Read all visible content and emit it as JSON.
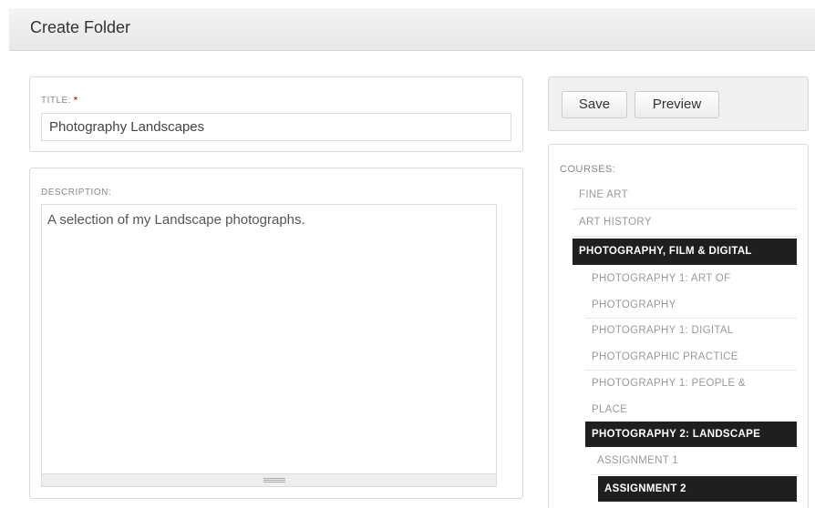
{
  "header": {
    "title": "Create Folder"
  },
  "form": {
    "title_label": "TITLE:",
    "required_marker": "*",
    "title_value": "Photography Landscapes",
    "description_label": "DESCRIPTION:",
    "description_value": "A selection of my Landscape photographs."
  },
  "actions": {
    "save_label": "Save",
    "preview_label": "Preview"
  },
  "courses": {
    "label": "COURSES:",
    "fine_art": "FINE ART",
    "art_history": "ART HISTORY",
    "photo_film_digital": "PHOTOGRAPHY, FILM & DIGITAL",
    "photo1_art_line1": "PHOTOGRAPHY 1: ART OF",
    "photo1_art_line2": "PHOTOGRAPHY",
    "photo1_digital_line1": "PHOTOGRAPHY 1: DIGITAL",
    "photo1_digital_line2": "PHOTOGRAPHIC PRACTICE",
    "photo1_people_line1": "PHOTOGRAPHY 1: PEOPLE &",
    "photo1_people_line2": "PLACE",
    "photo2_landscape": "PHOTOGRAPHY 2: LANDSCAPE",
    "assignment1": "ASSIGNMENT 1",
    "assignment2": "ASSIGNMENT 2"
  }
}
